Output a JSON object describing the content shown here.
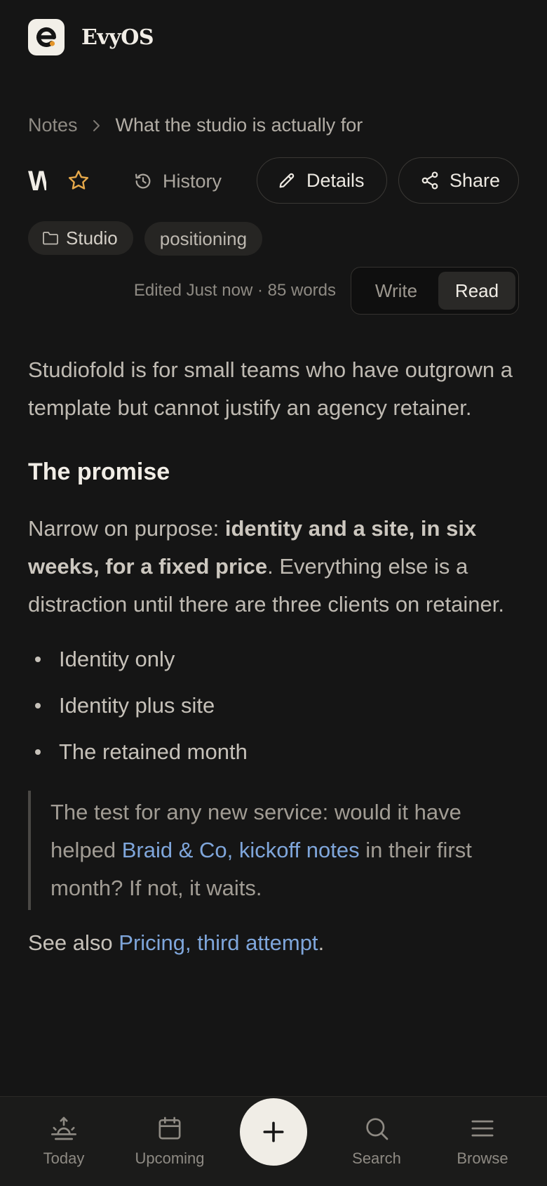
{
  "app": {
    "name": "EvyOS",
    "accent_color": "#e5962a",
    "link_color": "#7fa6db"
  },
  "breadcrumb": {
    "root": "Notes",
    "current": "What the studio is actually for"
  },
  "note": {
    "title": "What the studio is actually for",
    "starred": false
  },
  "toolbar": {
    "history_label": "History",
    "details_label": "Details",
    "share_label": "Share"
  },
  "tags": {
    "folder": "Studio",
    "tag": "positioning"
  },
  "meta": {
    "text": "Edited Just now · 85 words"
  },
  "mode": {
    "write": "Write",
    "read": "Read",
    "active": "Read"
  },
  "content": {
    "intro": "Studiofold is for small teams who have outgrown a template but cannot justify an agency retainer.",
    "heading": "The promise",
    "para_lead": "Narrow on purpose: ",
    "para_bold": "identity and a site, in six weeks, for a fixed price",
    "para_rest": ". Everything else is a distraction until there are three clients on retainer.",
    "bullets": [
      "Identity only",
      "Identity plus site",
      "The retained month"
    ],
    "quote_lead": "The test for any new service: would it have helped ",
    "quote_link": "Braid & Co, kickoff notes",
    "quote_rest": " in their first month? If not, it waits.",
    "see_also_lead": "See also ",
    "see_also_link": "Pricing, third attempt",
    "see_also_end": "."
  },
  "nav": {
    "today": "Today",
    "upcoming": "Upcoming",
    "search": "Search",
    "browse": "Browse"
  }
}
